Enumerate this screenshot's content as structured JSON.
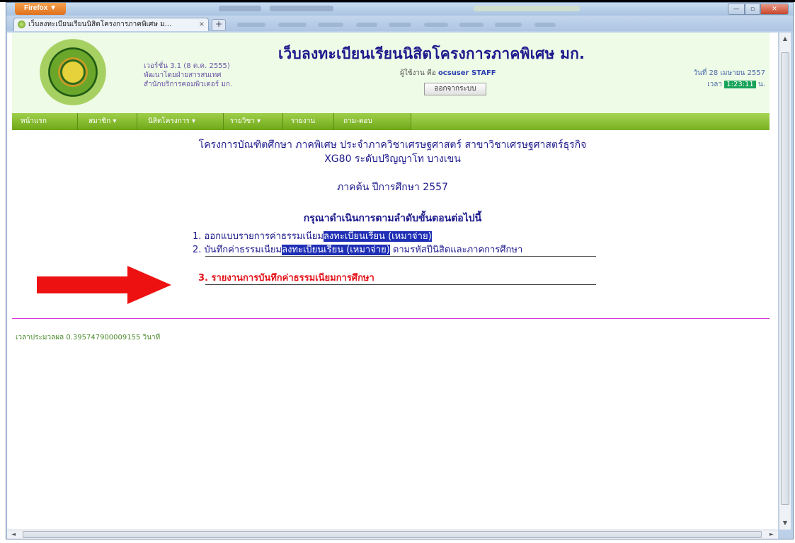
{
  "browser": {
    "menu_button": "Firefox ▼",
    "tab_title": "เว็บลงทะเบียนเรียนนิสิตโครงการภาคพิเศษ ม...",
    "tab_close": "×",
    "new_tab": "+",
    "window_controls": {
      "minimize": "—",
      "maximize": "▫",
      "close": "✕"
    }
  },
  "header": {
    "title": "เว็บลงทะเบียนเรียนนิสิตโครงการภาคพิเศษ มก.",
    "version_lines": [
      "เวอร์ชั่น 3.1 (8 ต.ค. 2555)",
      "พัฒนาโดยฝ่ายสารสนเทศ",
      "สำนักบริการคอมพิวเตอร์ มก."
    ],
    "user_label": "ผู้ใช้งาน คือ",
    "user_name": "ocsuser STAFF",
    "logout_label": "ออกจากระบบ",
    "date": "วันที่ 28 เมษายน 2557",
    "time_label": "เวลา",
    "time_value": "1:23:11",
    "time_suffix": "น."
  },
  "nav": {
    "items": [
      "หน้าแรก",
      "สมาชิก ▾",
      "นิสิตโครงการ ▾",
      "รายวิชา ▾",
      "รายงาน",
      "ถาม-ตอบ"
    ]
  },
  "main": {
    "program_line1": "โครงการบัณฑิตศึกษา ภาคพิเศษ ประจำภาควิชาเศรษฐศาสตร์ สาขาวิชาเศรษฐศาสตร์ธุรกิจ",
    "program_line2": "XG80 ระดับปริญญาโท บางเขน",
    "semester": "ภาคต้น ปีการศึกษา 2557",
    "instruction": "กรุณาดำเนินการตามลำดับขั้นตอนต่อไปนี้",
    "step1_prefix": "1. ออกแบบรายการค่าธรรมเนียม",
    "step1_highlight": "ลงทะเบียนเรียน (เหมาจ่าย)",
    "step2_prefix": "2. บันทึกค่าธรรมเนียม",
    "step2_highlight": "ลงทะเบียนเรียน (เหมาจ่าย)",
    "step2_suffix": " ตามรหัสปีนิสิตและภาคการศึกษา",
    "step3": "3. รายงานการบันทึกค่าธรรมเนียมการศึกษา",
    "arrow_color": "#ee1111"
  },
  "footer": {
    "elapsed": "เวลาประมวลผล 0.395747900009155 วินาที"
  },
  "scrollbar": {
    "up": "▲",
    "down": "▼",
    "left": "◄",
    "right": "►"
  }
}
